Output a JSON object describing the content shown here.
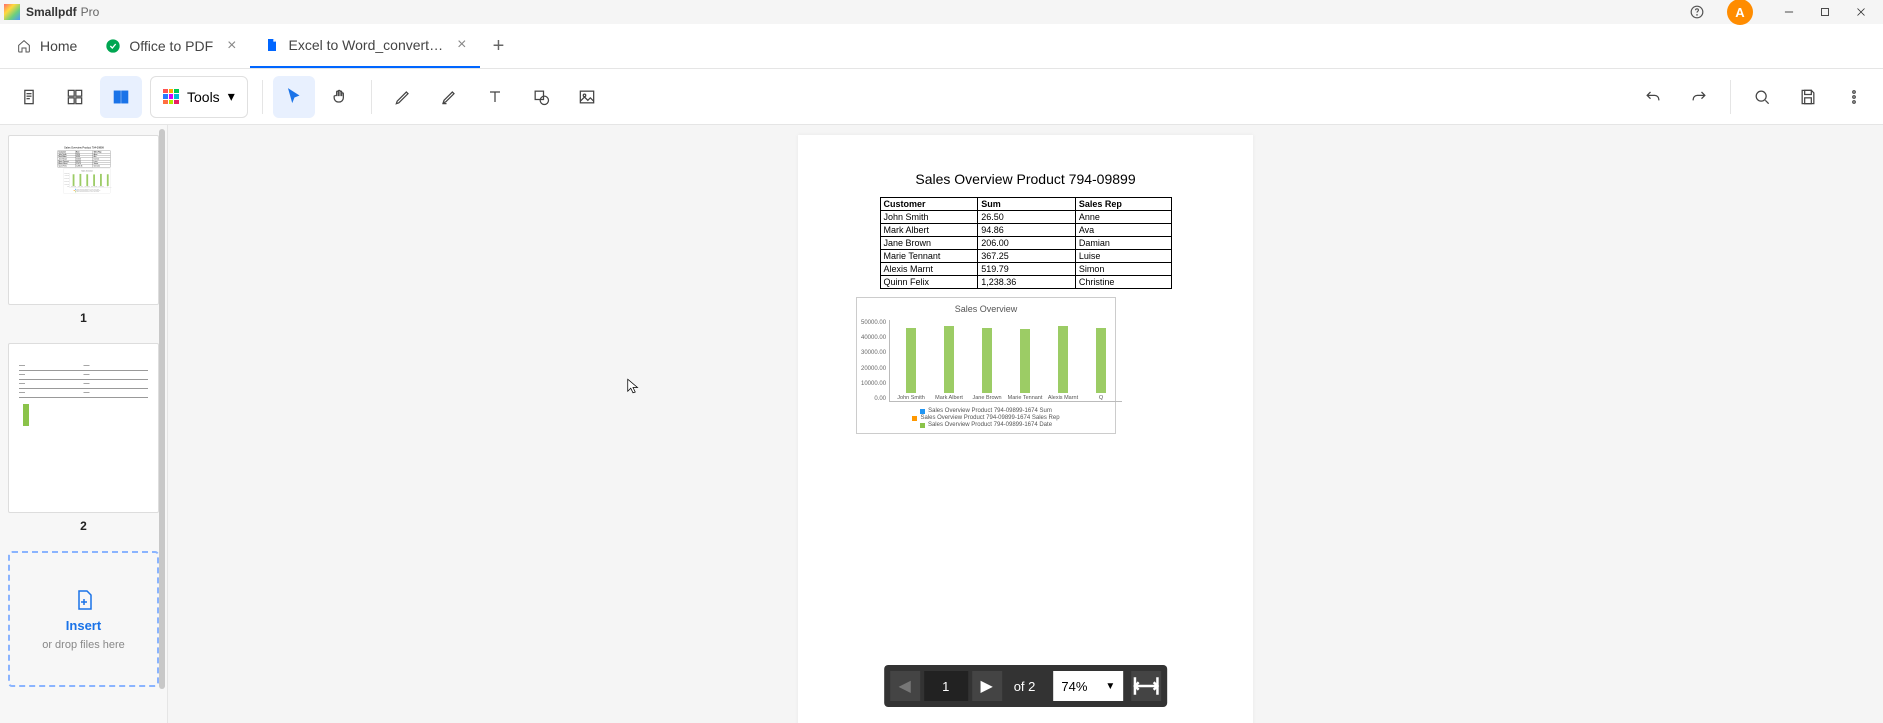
{
  "app": {
    "name": "Smallpdf",
    "subname": "Pro",
    "avatar_letter": "A"
  },
  "tabs": [
    {
      "label": "Home",
      "icon": "home",
      "closable": false
    },
    {
      "label": "Office to PDF",
      "icon": "check",
      "closable": true
    },
    {
      "label": "Excel to Word_convert…",
      "icon": "file",
      "closable": true,
      "active": true
    }
  ],
  "toolbar": {
    "tools_label": "Tools"
  },
  "sidebar": {
    "thumbs": [
      "1",
      "2"
    ],
    "insert": {
      "label": "Insert",
      "hint": "or drop files here"
    }
  },
  "document": {
    "title": "Sales Overview Product 794-09899",
    "table": {
      "headers": [
        "Customer",
        "Sum",
        "Sales Rep"
      ],
      "rows": [
        [
          "John Smith",
          "26.50",
          "Anne"
        ],
        [
          "Mark Albert",
          "94.86",
          "Ava"
        ],
        [
          "Jane Brown",
          "206.00",
          "Damian"
        ],
        [
          "Marie Tennant",
          "367.25",
          "Luise"
        ],
        [
          "Alexis Marnt",
          "519.79",
          "Simon"
        ],
        [
          "Quinn Felix",
          "1,238.36",
          "Christine"
        ]
      ]
    }
  },
  "chart_data": {
    "type": "bar",
    "title": "Sales Overview",
    "categories": [
      "John Smith",
      "Mark Albert",
      "Jane Brown",
      "Marie Tennant",
      "Alexis Marnt",
      "Q"
    ],
    "values": [
      44000,
      45000,
      44000,
      43000,
      45000,
      44000
    ],
    "ylim": [
      0,
      50000
    ],
    "yticks": [
      "50000.00",
      "40000.00",
      "30000.00",
      "20000.00",
      "10000.00",
      "0.00"
    ],
    "legend": [
      "Sales Overview Product 794-09899-1674 Sum",
      "Sales Overview Product 794-09899-1674 Sales Rep",
      "Sales Overview Product 794-09899-1674 Date"
    ]
  },
  "pager": {
    "current_page": "1",
    "total_text": "of 2",
    "zoom": "74%"
  }
}
